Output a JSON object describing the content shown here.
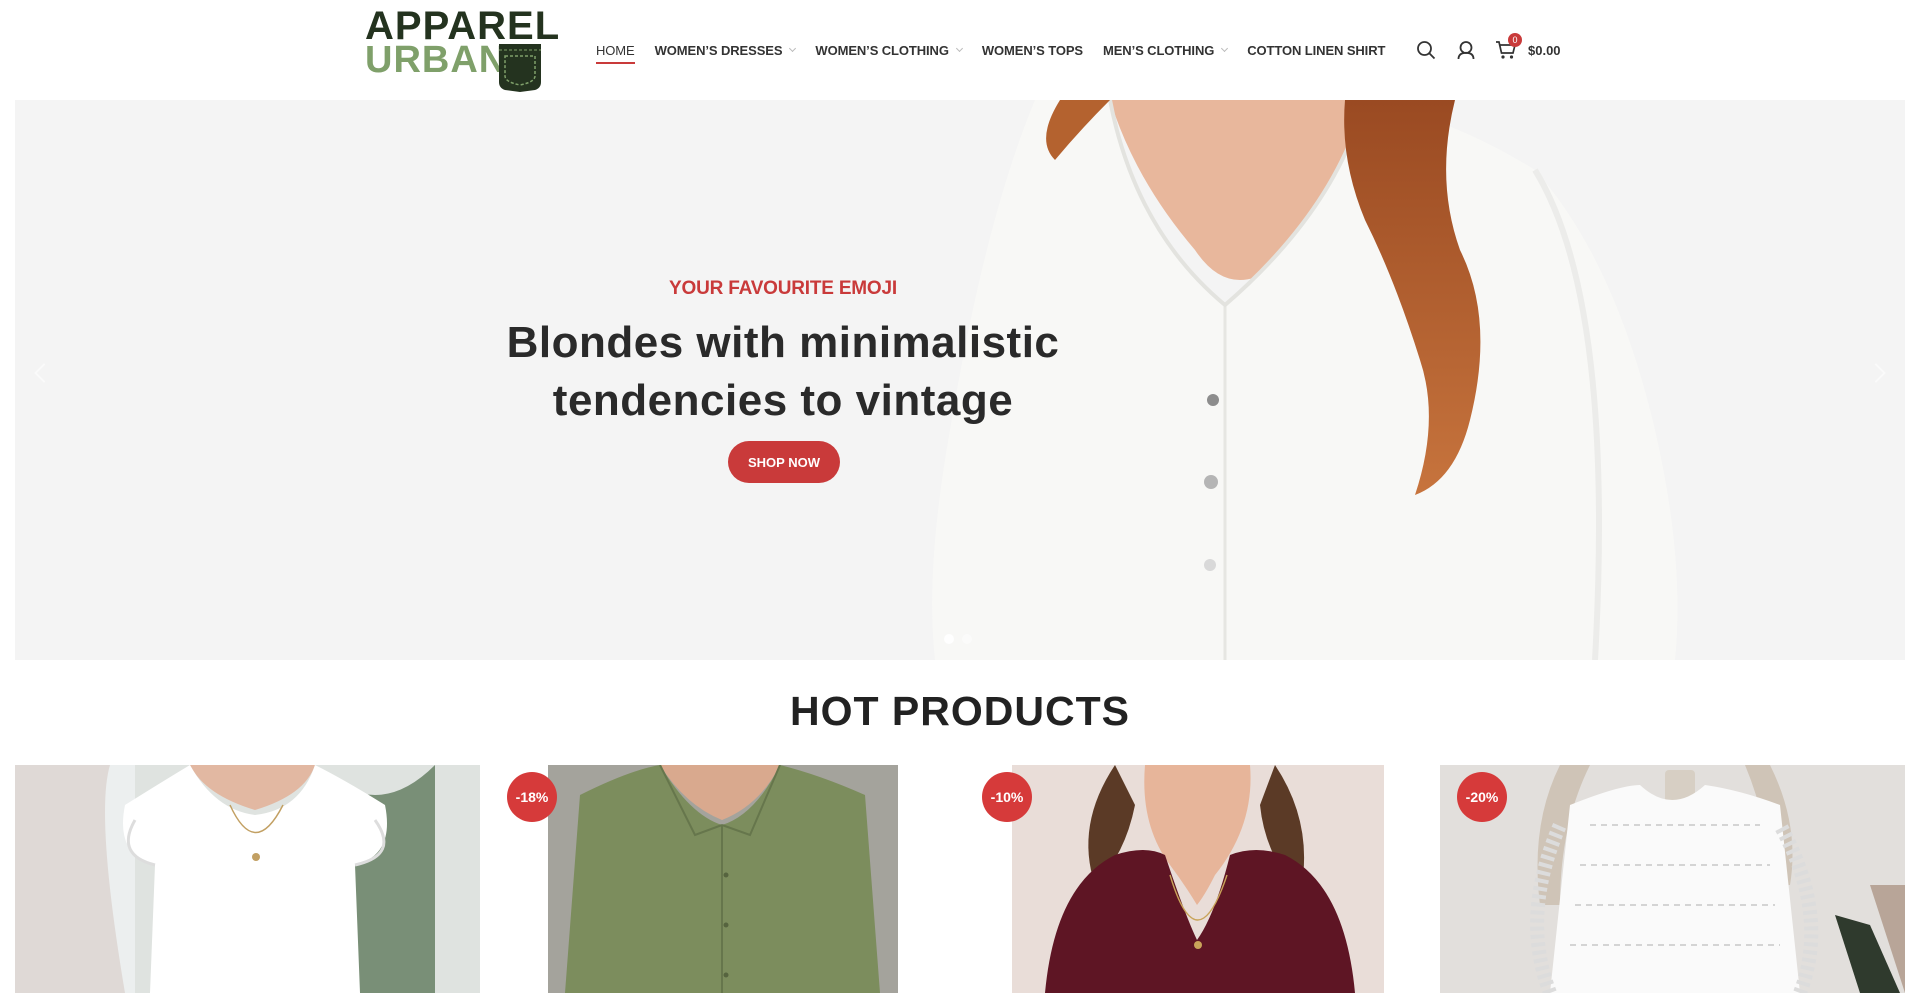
{
  "brand": {
    "line1": "APPAREL",
    "line2": "URBAN"
  },
  "nav": {
    "items": [
      {
        "label": "HOME"
      },
      {
        "label": "WOMEN’S DRESSES"
      },
      {
        "label": "WOMEN’S CLOTHING"
      },
      {
        "label": "WOMEN’S TOPS"
      },
      {
        "label": "MEN’S CLOTHING"
      },
      {
        "label": "COTTON LINEN SHIRT"
      }
    ]
  },
  "header_tools": {
    "cart_count": "0",
    "cart_total": "$0.00"
  },
  "hero": {
    "subtitle": "YOUR FAVOURITE EMOJI",
    "title_line1": "Blondes with minimalistic",
    "title_line2": "tendencies to vintage",
    "button_label": "SHOP NOW"
  },
  "hot_products": {
    "title": "HOT PRODUCTS",
    "items": [
      {
        "badge": ""
      },
      {
        "badge": "-18%"
      },
      {
        "badge": "-10%"
      },
      {
        "badge": "-20%"
      }
    ]
  },
  "colors": {
    "accent": "#c93a3a",
    "brand_dark": "#24331f",
    "brand_green": "#7fa06a"
  }
}
